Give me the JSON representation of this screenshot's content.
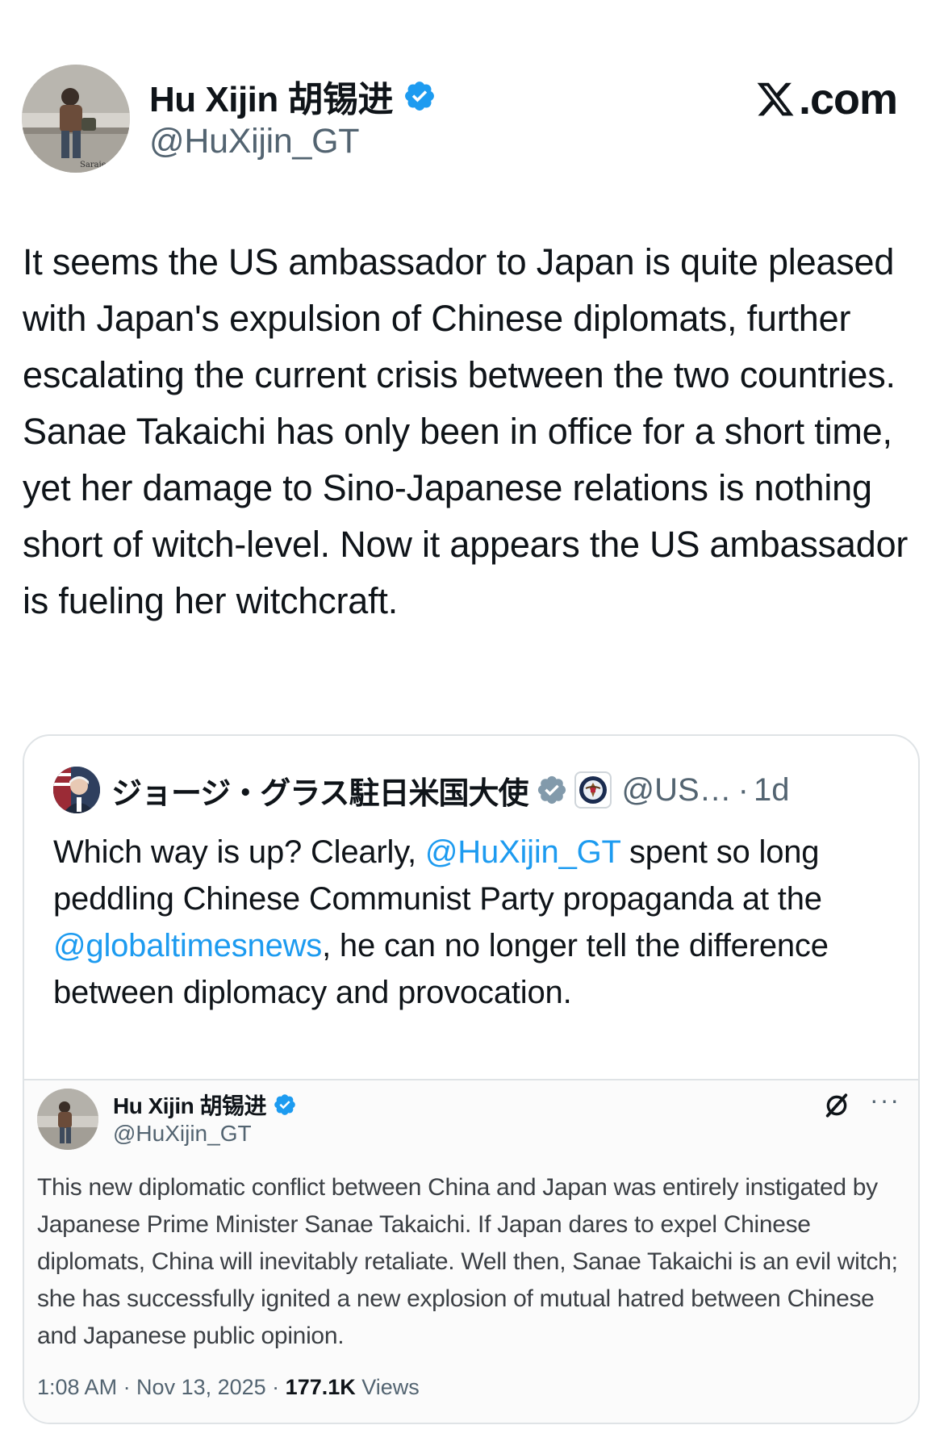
{
  "header": {
    "author_name": "Hu Xijin 胡锡进",
    "author_handle": "@HuXijin_GT",
    "avatar_caption": "Saraje",
    "site_logo_text": ".com",
    "icons": {
      "verified": "verified-badge-icon",
      "logo": "x-logo-icon"
    }
  },
  "tweet": {
    "text": "It seems the US ambassador to Japan is quite pleased with Japan's expulsion of Chinese diplomats, further escalating the current crisis between the two countries. Sanae Takaichi has only been in office for a short time, yet her damage to Sino-Japanese relations is nothing short of witch-level. Now it appears the US ambassador is fueling her witchcraft."
  },
  "quote": {
    "author_name": "ジョージ・グラス駐日米国大使",
    "handle": "@US…",
    "separator": "·",
    "time": "1d",
    "text_parts": [
      "Which way is up? Clearly, ",
      "@HuXijin_GT",
      " spent so long peddling Chinese Communist Party propaganda at the ",
      "@globaltimesnews",
      ", he can no longer tell the difference between diplomacy and provocation."
    ],
    "embedded": {
      "author_name": "Hu Xijin 胡锡进",
      "handle": "@HuXijin_GT",
      "more": "···",
      "text": "This new diplomatic conflict between China and Japan was entirely instigated by Japanese Prime Minister Sanae Takaichi. If Japan dares to expel Chinese diplomats, China will inevitably retaliate. Well then, Sanae Takaichi is an evil witch; she has successfully ignited a new explosion of mutual hatred between Chinese and Japanese public opinion.",
      "meta_time": "1:08 AM · Nov 13, 2025 · ",
      "views_count": "177.1K",
      "views_label": " Views"
    }
  },
  "colors": {
    "text": "#0f1419",
    "secondary": "#536471",
    "link": "#1d9bf0",
    "verified_blue": "#1d9bf0",
    "verified_gray": "#829aab",
    "border": "#dfe3e6"
  }
}
